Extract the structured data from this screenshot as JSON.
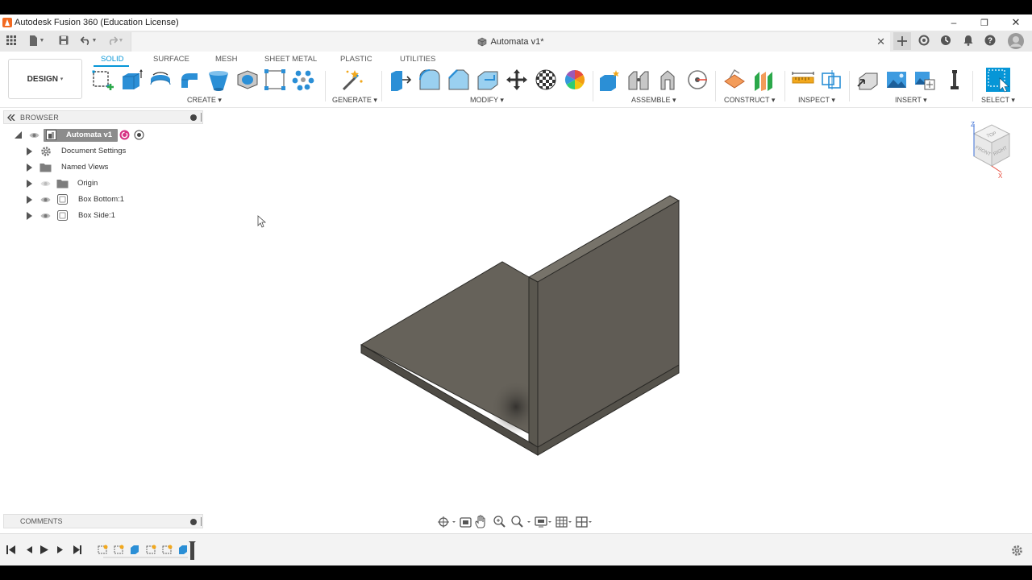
{
  "window": {
    "title": "Autodesk Fusion 360 (Education License)",
    "minimize": "–",
    "maximize": "❐",
    "close": "✕"
  },
  "document": {
    "tab_title": "Automata v1*",
    "close": "✕"
  },
  "workspace": {
    "label": "DESIGN",
    "caret": "▾"
  },
  "ribbon": {
    "tabs": [
      "SOLID",
      "SURFACE",
      "MESH",
      "SHEET METAL",
      "PLASTIC",
      "UTILITIES"
    ],
    "active_tab": "SOLID",
    "groups": [
      "CREATE ▾",
      "GENERATE ▾",
      "MODIFY ▾",
      "ASSEMBLE ▾",
      "CONSTRUCT ▾",
      "INSPECT ▾",
      "INSERT ▾",
      "SELECT ▾"
    ]
  },
  "browser": {
    "title": "BROWSER",
    "root": "Automata v1",
    "items": [
      "Document Settings",
      "Named Views",
      "Origin",
      "Box Bottom:1",
      "Box Side:1"
    ]
  },
  "comments": {
    "title": "COMMENTS"
  },
  "viewcube": {
    "top": "TOP",
    "front": "FRONT",
    "right": "RIGHT",
    "z": "Z",
    "x": "X"
  },
  "colors": {
    "accent": "#0696d7",
    "model_face": "#66625a",
    "model_side": "#4e4b45",
    "model_edge": "#2a2926",
    "fusion_orange": "#f26a21"
  }
}
